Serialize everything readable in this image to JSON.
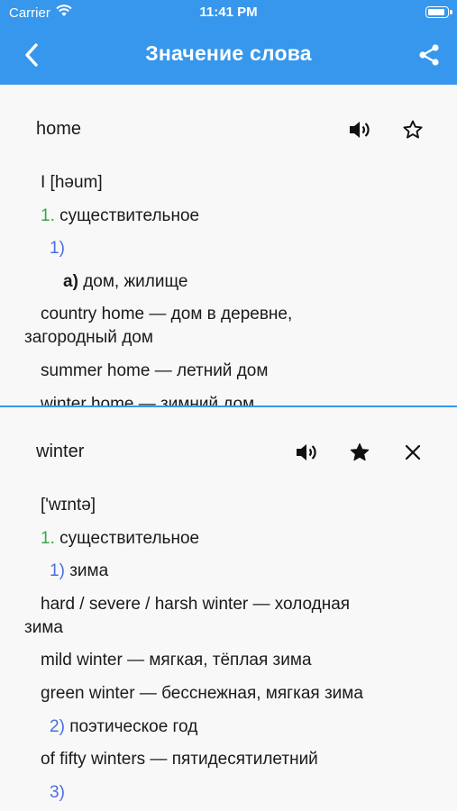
{
  "status": {
    "carrier": "Carrier",
    "time": "11:41 PM"
  },
  "header": {
    "title": "Значение слова"
  },
  "panel_top": {
    "word": "home",
    "favorite": false,
    "lines": [
      {
        "type": "plain",
        "text": "I [həum]"
      },
      {
        "type": "pos",
        "num": "1.",
        "text": "существительное"
      },
      {
        "type": "sense",
        "num": "1)",
        "text": ""
      },
      {
        "type": "sub",
        "num": "а)",
        "text": "дом, жилище"
      },
      {
        "type": "wrap",
        "text1": "country home — дом в деревне,",
        "text2": "загородный дом"
      },
      {
        "type": "plain",
        "text": "summer home — летний дом"
      },
      {
        "type": "plain",
        "text": "winter home — зимний дом"
      }
    ]
  },
  "panel_bottom": {
    "word": "winter",
    "favorite": true,
    "lines": [
      {
        "type": "plain",
        "text": "['wɪntə]"
      },
      {
        "type": "pos",
        "num": "1.",
        "text": "существительное"
      },
      {
        "type": "sense",
        "num": "1)",
        "text": "зима"
      },
      {
        "type": "wrap",
        "text1": "hard / severe / harsh winter — холодная",
        "text2": "зима"
      },
      {
        "type": "plain",
        "text": "mild winter — мягкая, тёплая зима"
      },
      {
        "type": "plain",
        "text": "green winter — бесснежная, мягкая зима"
      },
      {
        "type": "sense",
        "num": "2)",
        "text": "поэтическое год"
      },
      {
        "type": "plain",
        "text": "of fifty winters — пятидесятилетний"
      },
      {
        "type": "sense",
        "num": "3)",
        "text": ""
      }
    ]
  },
  "icons": {
    "back": "chevron-left-icon",
    "share": "share-icon",
    "sound": "speaker-icon",
    "star_outline": "star-outline-icon",
    "star_filled": "star-filled-icon",
    "close": "close-icon"
  },
  "colors": {
    "accent": "#3797ec",
    "green": "#3aa64c",
    "blue": "#4a6fe0"
  }
}
